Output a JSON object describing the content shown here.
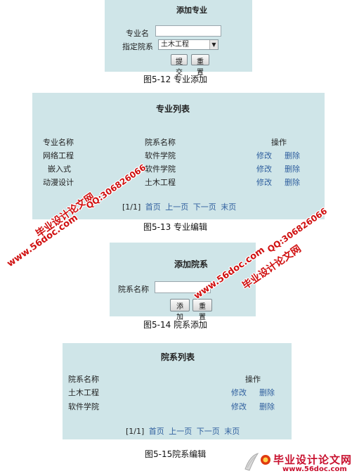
{
  "fig12": {
    "title": "添加专业",
    "major_label": "专业名",
    "dept_label": "指定院系",
    "dept_selected": "土木工程",
    "submit_label": "提交",
    "reset_label": "重置",
    "caption": "图5-12  专业添加"
  },
  "fig13": {
    "title": "专业列表",
    "col_major": "专业名称",
    "col_dept": "院系名称",
    "col_ops": "操作",
    "rows": [
      {
        "major": "网络工程",
        "dept": "软件学院",
        "edit": "修改",
        "del": "删除"
      },
      {
        "major": "嵌入式",
        "dept": "软件学院",
        "edit": "修改",
        "del": "删除"
      },
      {
        "major": "动漫设计",
        "dept": "土木工程",
        "edit": "修改",
        "del": "删除"
      }
    ],
    "pager": {
      "count": "[1/1]",
      "first": "首页",
      "prev": "上一页",
      "next": "下一页",
      "last": "末页"
    },
    "caption": "图5-13  专业编辑"
  },
  "fig14": {
    "title": "添加院系",
    "dept_label": "院系名称",
    "add_label": "添加",
    "reset_label": "重置",
    "caption": "图5-14  院系添加"
  },
  "fig15": {
    "title": "院系列表",
    "col_dept": "院系名称",
    "col_ops": "操作",
    "rows": [
      {
        "dept": "土木工程",
        "edit": "修改",
        "del": "删除"
      },
      {
        "dept": "软件学院",
        "edit": "修改",
        "del": "删除"
      }
    ],
    "pager": {
      "count": "[1/1]",
      "first": "首页",
      "prev": "上一页",
      "next": "下一页",
      "last": "末页"
    },
    "caption": "图5-15院系编辑"
  },
  "watermarks": {
    "site_cn": "毕业设计论文网",
    "qq": "QQ:306826066",
    "url": "www.56doc.com",
    "red": "#d01010"
  },
  "brand": {
    "name": "毕业设计论文网",
    "url": "www.56doc.com"
  },
  "colors": {
    "panel": "#cfe5e8",
    "link": "#2f5f9e"
  }
}
